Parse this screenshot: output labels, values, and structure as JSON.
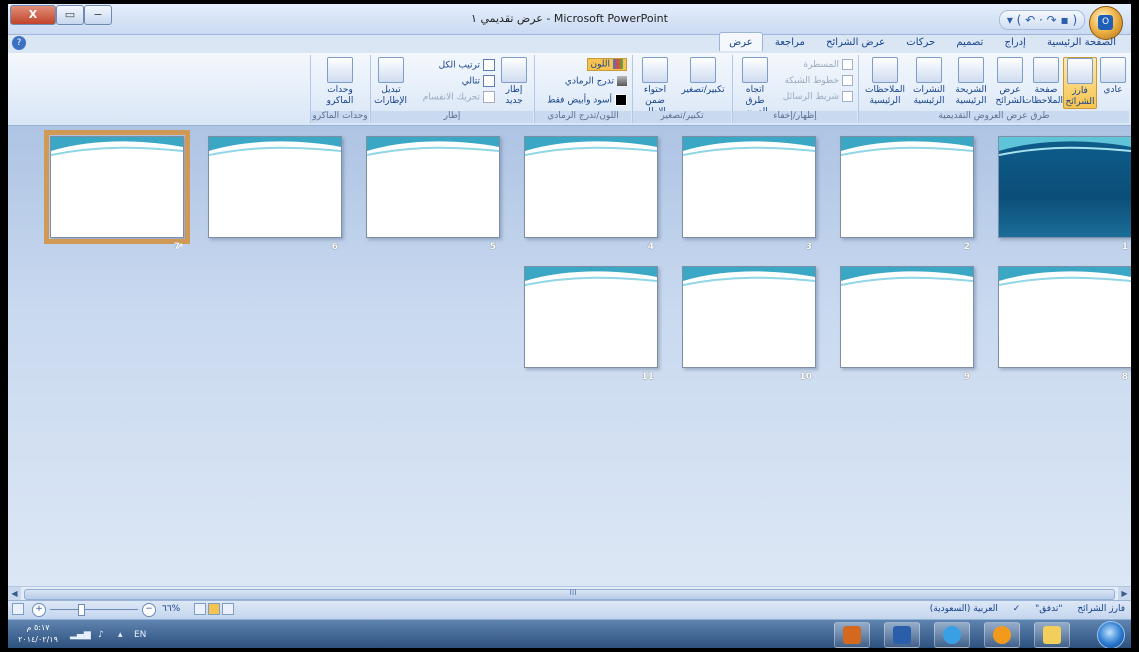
{
  "window": {
    "title": "Microsoft PowerPoint - عرض تقديمي ١",
    "close_label": "X",
    "max_label": "▭",
    "min_label": "−",
    "qat_label": "▾ ( ↶ · ↷ ▪ )",
    "office_label": "O"
  },
  "tabs": [
    "الصفحة الرئيسية",
    "إدراج",
    "تصميم",
    "حركات",
    "عرض الشرائح",
    "مراجعة",
    "عرض"
  ],
  "ribbon": {
    "group_views": {
      "label": "طرق عرض العروض التقديمية",
      "normal": "عادي",
      "sorter": "فارز الشرائح",
      "notes": "صفحة الملاحظات",
      "show": "عرض الشرائح",
      "slide_master": "الشريحة الرئيسية",
      "handout_master": "النشرات الرئيسية",
      "notes_master": "الملاحظات الرئيسية"
    },
    "group_showhide": {
      "label": "إظهار/إخفاء",
      "ruler": "المسطرة",
      "gridlines": "خطوط الشبكة",
      "messagebar": "شريط الرسائل",
      "direction": "اتجاه طرق العرض"
    },
    "group_zoom": {
      "label": "تكبير/تصغير",
      "zoom": "تكبير/تصغير",
      "fit": "احتواء ضمن الإطار"
    },
    "group_color": {
      "label": "اللون/تدرج الرمادي",
      "color": "اللون",
      "grayscale": "تدرج الرمادي",
      "bw": "أسود وأبيض فقط"
    },
    "group_window": {
      "label": "إطار",
      "new": "إطار جديد",
      "arrange": "ترتيب الكل",
      "cascade": "تتالي",
      "split": "تحريك الانقسام",
      "switch": "تبديل الإطارات"
    },
    "group_macros": {
      "label": "وحدات الماكرو",
      "macros": "وحدات الماكرو"
    }
  },
  "slides": {
    "row1": [
      "1",
      "2",
      "3",
      "4",
      "5",
      "6",
      "7"
    ],
    "row2": [
      "8",
      "9",
      "10",
      "11"
    ],
    "transition_mark": "↗"
  },
  "scroll": {
    "mid_label": "III"
  },
  "status": {
    "view": "فارز الشرائح",
    "theme": "\"تدفق\"",
    "language": "العربية (السعودية)",
    "zoom_pct": "٦٦%",
    "zoom_minus": "−",
    "zoom_plus": "+"
  },
  "taskbar": {
    "time": "٥:١٧ م",
    "date": "٢٠١٤/٠٢/١٩",
    "lang": "EN"
  }
}
